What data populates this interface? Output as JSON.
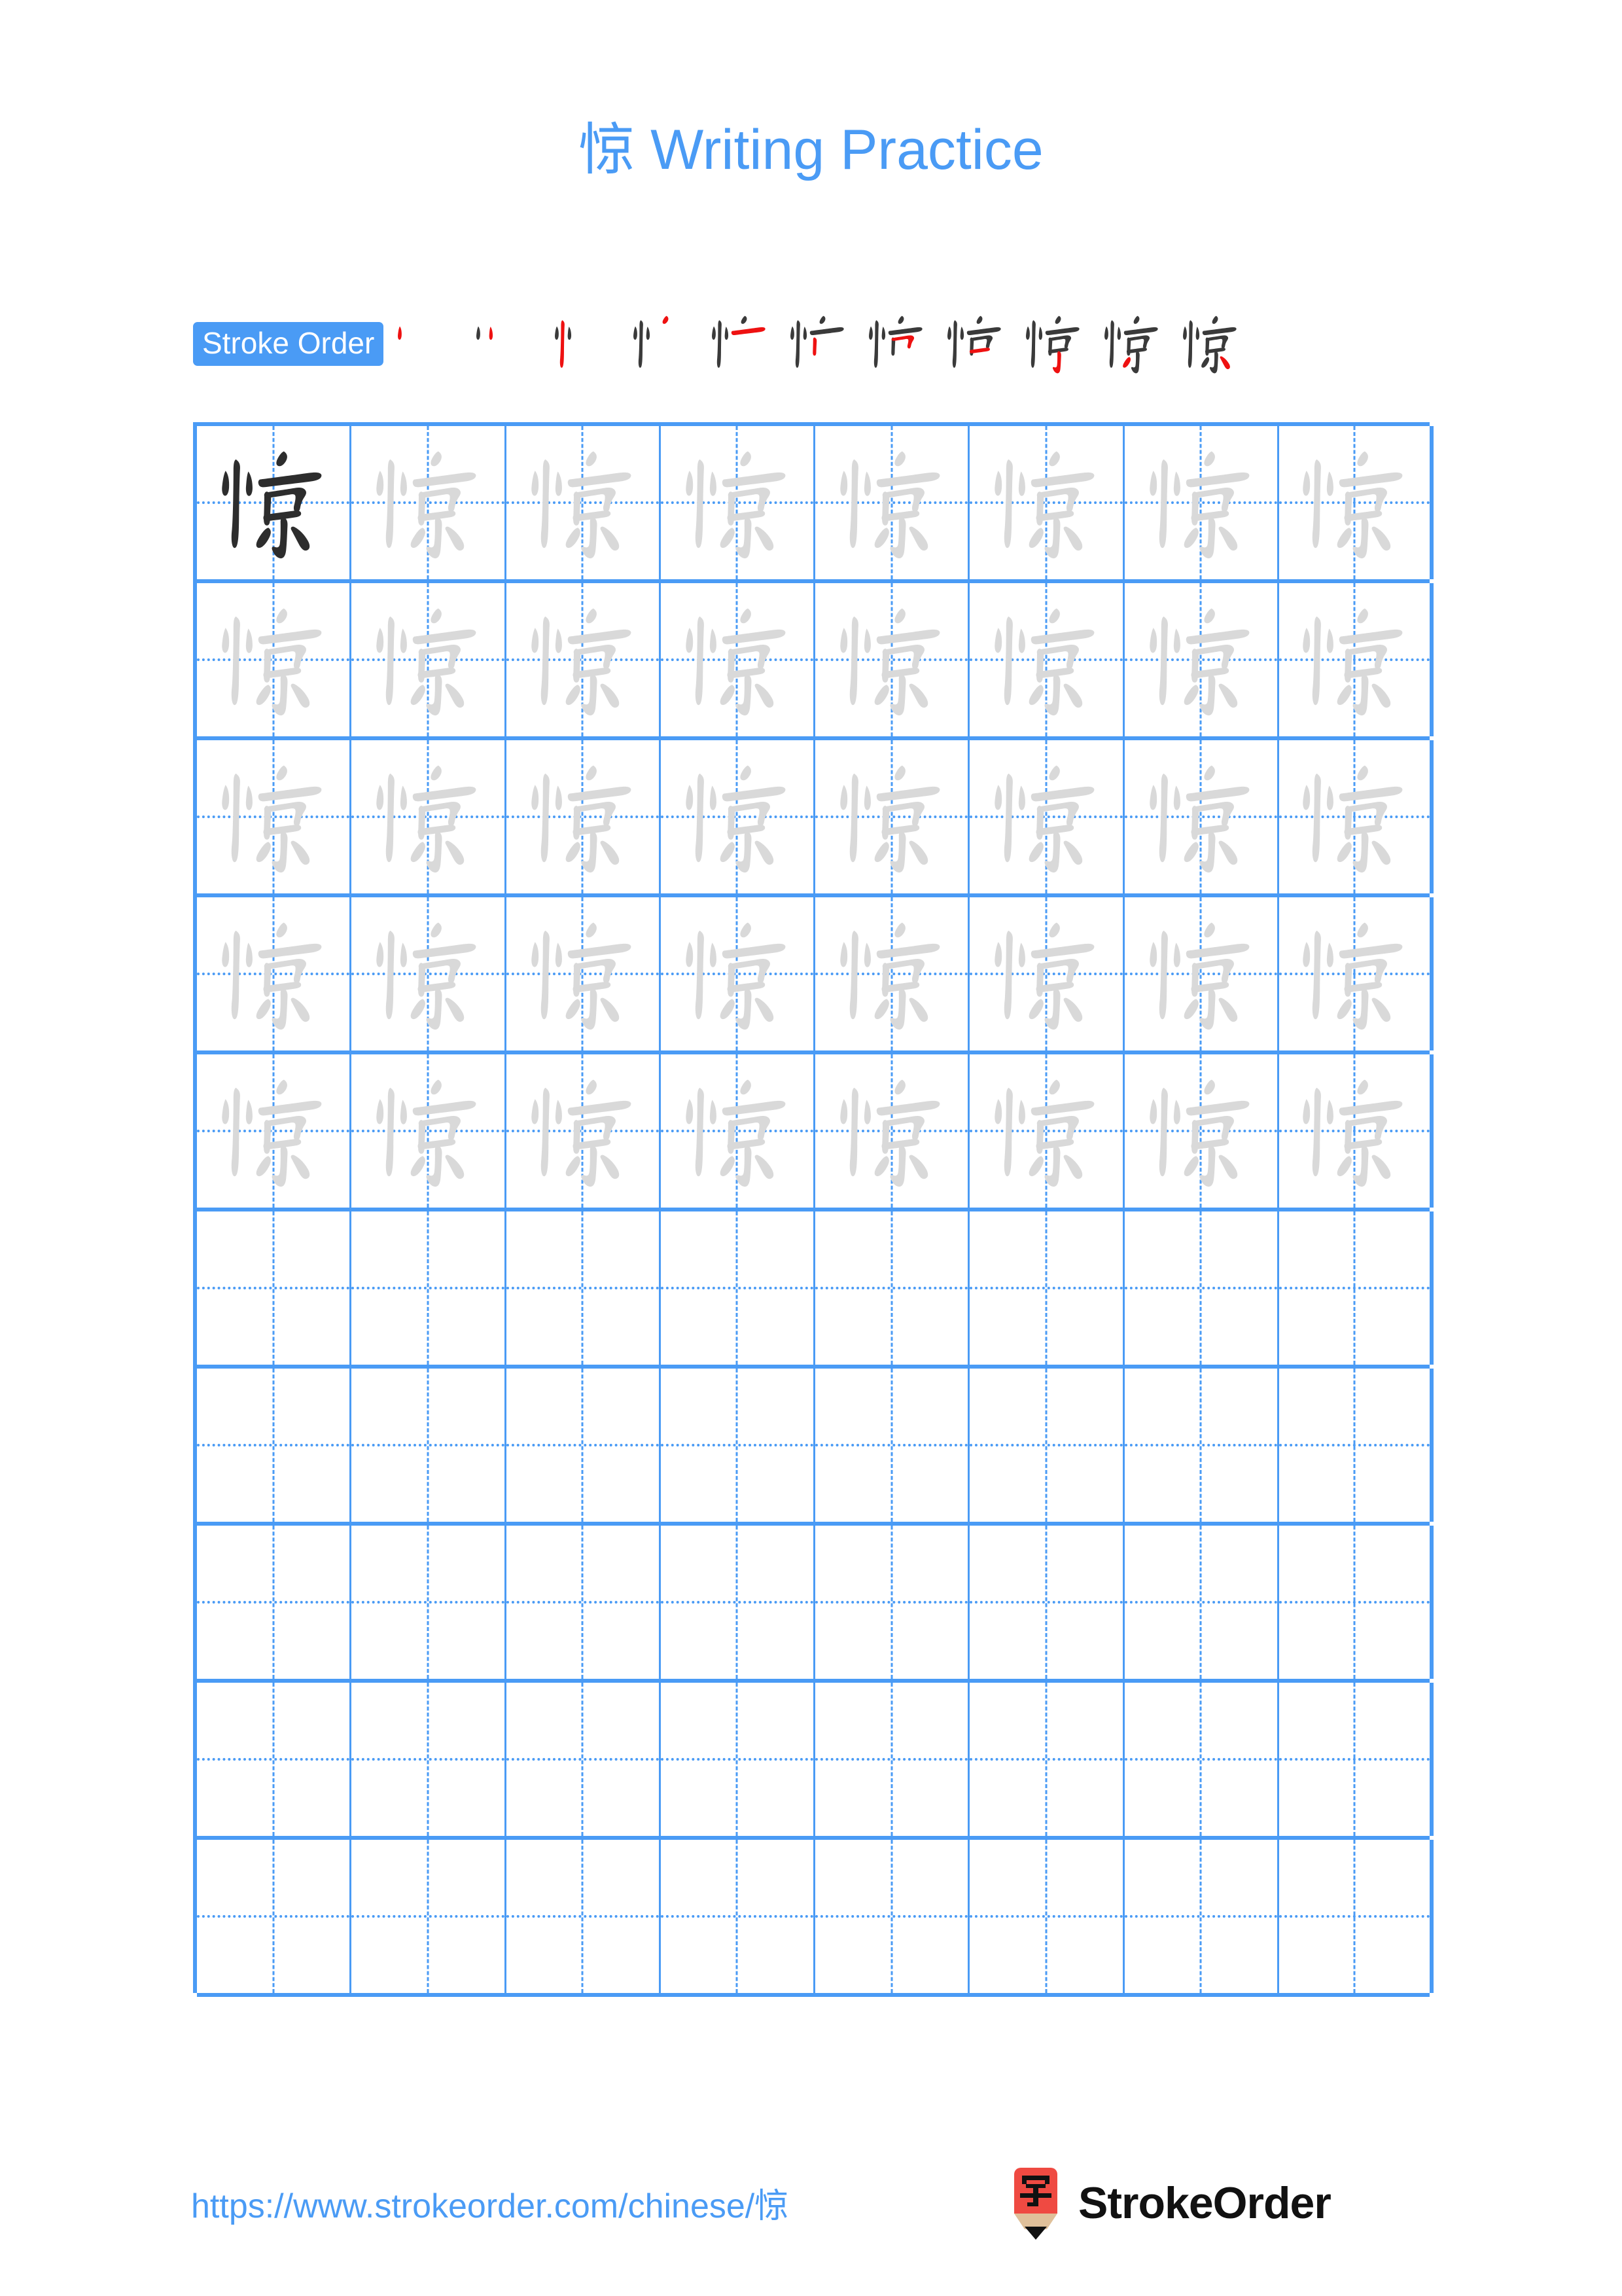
{
  "page": {
    "title": "惊 Writing Practice",
    "character": "惊",
    "accent_color": "#4a9bf5",
    "grid_line_color": "#4a9bf5",
    "trace_char_color": "#d9d9d9",
    "model_char_color": "#2d2d2d",
    "stroke_new_color": "#ee1111",
    "stroke_done_color": "#3a3a3a"
  },
  "stroke_order": {
    "label": "Stroke Order",
    "total_strokes": 11,
    "steps": [
      {
        "index": 1,
        "partial": "丶"
      },
      {
        "index": 2,
        "partial": "丷"
      },
      {
        "index": 3,
        "partial": "忄"
      },
      {
        "index": 4,
        "partial": "忄丶"
      },
      {
        "index": 5,
        "partial": "忄亠"
      },
      {
        "index": 6,
        "partial": "忄广"
      },
      {
        "index": 7,
        "partial": "忄宀口"
      },
      {
        "index": 8,
        "partial": "忄京上"
      },
      {
        "index": 9,
        "partial": "忄京丿"
      },
      {
        "index": 10,
        "partial": "忄京丶"
      },
      {
        "index": 11,
        "partial": "惊"
      }
    ]
  },
  "grid": {
    "columns": 8,
    "rows": 10,
    "filled_rows": 5,
    "empty_rows": 5,
    "model_cell": {
      "row": 1,
      "column": 1
    }
  },
  "footer": {
    "url": "https://www.strokeorder.com/chinese/惊",
    "brand_name": "StrokeOrder",
    "logo": {
      "icon_character": "字",
      "body_color": "#ef4a42",
      "wood_color": "#e0c09a",
      "tip_color": "#111111"
    }
  }
}
